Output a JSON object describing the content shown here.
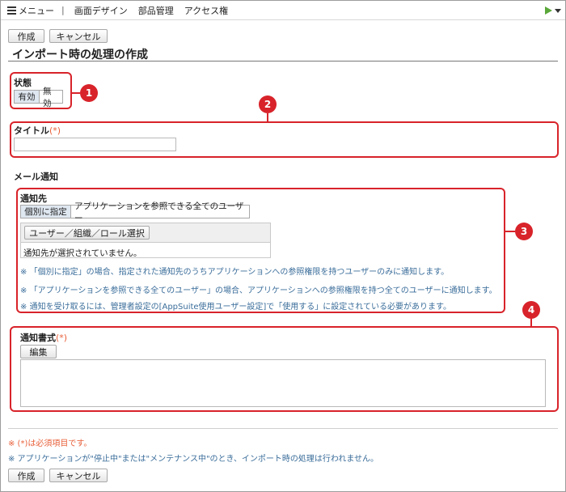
{
  "menu_bar": {
    "menu_label": "メニュー",
    "separator": "|",
    "items": [
      "画面デザイン",
      "部品管理",
      "アクセス権"
    ]
  },
  "toolbar": {
    "create_label": "作成",
    "cancel_label": "キャンセル"
  },
  "page_title": "インポート時の処理の作成",
  "status": {
    "label": "状態",
    "options": [
      "有効",
      "無効"
    ],
    "selected": "有効"
  },
  "title_field": {
    "label": "タイトル",
    "required_mark": "(*)",
    "value": ""
  },
  "mail_notification": {
    "heading": "メール通知",
    "recipients": {
      "label": "通知先",
      "modes": [
        "個別に指定",
        "アプリケーションを参照できる全てのユーザー"
      ],
      "selected_mode": "個別に指定",
      "select_button": "ユーザー／組織／ロール選択",
      "empty_text": "通知先が選択されていません。"
    },
    "notes": [
      "「個別に指定」の場合、指定された通知先のうちアプリケーションへの参照権限を持つユーザーのみに通知します。",
      "「アプリケーションを参照できる全てのユーザー」の場合、アプリケーションへの参照権限を持つ全てのユーザーに通知します。",
      "通知を受け取るには、管理者設定の[AppSuite使用ユーザー設定]で「使用する」に設定されている必要があります。"
    ],
    "note_mark": "※",
    "format": {
      "label": "通知書式",
      "required_mark": "(*)",
      "edit_button": "編集",
      "value": ""
    }
  },
  "callouts": [
    "1",
    "2",
    "3",
    "4"
  ],
  "footer": {
    "required_note": "※ (*)は必須項目です。",
    "status_note": "※ アプリケーションが\"停止中\"または\"メンテナンス中\"のとき、インポート時の処理は行われません。"
  },
  "colors": {
    "callout": "#d8232a",
    "required": "#e8603a",
    "note_text": "#3a6d9a",
    "play_icon": "#5aa83a"
  },
  "icons": {
    "menu": "list-icon",
    "run": "play-icon",
    "dropdown": "caret-down-icon"
  }
}
